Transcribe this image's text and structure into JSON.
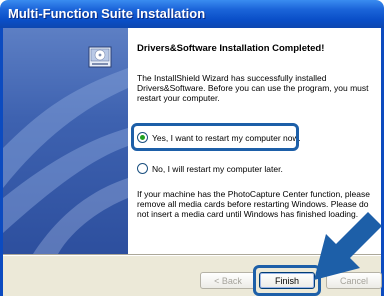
{
  "window": {
    "title": "Multi-Function Suite Installation"
  },
  "content": {
    "heading": "Drivers&Software Installation Completed!",
    "description": "The InstallShield Wizard has successfully installed Drivers&Software.  Before you can use the program, you must restart your computer.",
    "options": [
      {
        "label": "Yes, I want to restart my computer now.",
        "selected": true
      },
      {
        "label": "No, I will restart my computer later.",
        "selected": false
      }
    ],
    "note": "If your machine has the PhotoCapture Center function, please remove all media cards before restarting Windows. Please do not insert a media card until Windows has finished loading."
  },
  "buttons": {
    "back": "< Back",
    "finish": "Finish",
    "cancel": "Cancel"
  },
  "icons": {
    "logo": "computer-disk-icon",
    "annotation": "pointer-arrow-icon"
  },
  "colors": {
    "titlebar": "#0a4fc8",
    "highlight": "#1d5fa8",
    "arrow": "#1d5fa8"
  }
}
